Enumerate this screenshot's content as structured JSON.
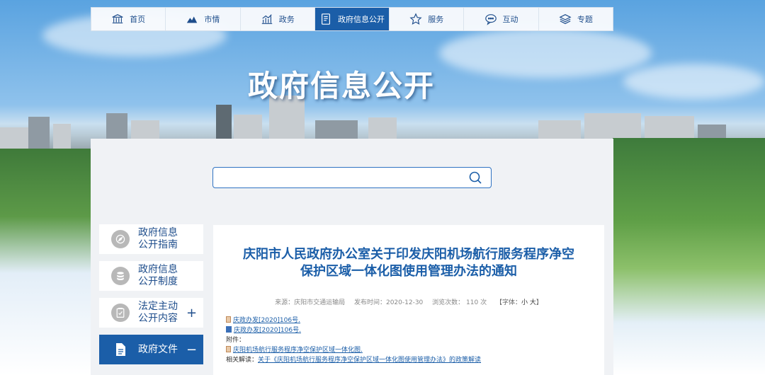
{
  "nav": [
    {
      "label": "首页",
      "icon": "bank-icon"
    },
    {
      "label": "市情",
      "icon": "mountain-icon"
    },
    {
      "label": "政务",
      "icon": "chart-icon"
    },
    {
      "label": "政府信息公开",
      "icon": "document-icon"
    },
    {
      "label": "服务",
      "icon": "star-icon"
    },
    {
      "label": "互动",
      "icon": "chat-icon"
    },
    {
      "label": "专题",
      "icon": "layers-icon"
    }
  ],
  "banner": {
    "title": "政府信息公开"
  },
  "search": {
    "placeholder": ""
  },
  "sidebar": [
    {
      "line1": "政府信息",
      "line2": "公开指南",
      "icon": "compass-icon"
    },
    {
      "line1": "政府信息",
      "line2": "公开制度",
      "icon": "database-icon"
    },
    {
      "line1": "法定主动",
      "line2": "公开内容",
      "icon": "clipboard-icon",
      "toggle": "+"
    },
    {
      "line1": "政府文件",
      "line2": "",
      "icon": "file-icon",
      "toggle": "−"
    }
  ],
  "article": {
    "title_line1": "庆阳市人民政府办公室关于印发庆阳机场航行服务程序净空",
    "title_line2": "保护区域一体化图使用管理办法的通知",
    "source": "来源：庆阳市交通运输局",
    "published": "发布时间：2020-12-30",
    "views": "浏览次数：  110   次",
    "font_size_label": "【字体：",
    "font_small": "小",
    "font_large": "大",
    "font_close": "】",
    "doc_link_1": "庆政办发[2020]106号.",
    "doc_link_2": "庆政办发[2020]106号.",
    "attachment_label": "附件：",
    "attachment_link": "庆阳机场航行服务程序净空保护区域一体化图.",
    "related_label": "相关解读：",
    "related_link": "关于《庆阳机场航行服务程序净空保护区域一体化图使用管理办法》的政策解读"
  },
  "colors": {
    "primary": "#1b5ea8",
    "nav_text": "#1f4e8c"
  }
}
